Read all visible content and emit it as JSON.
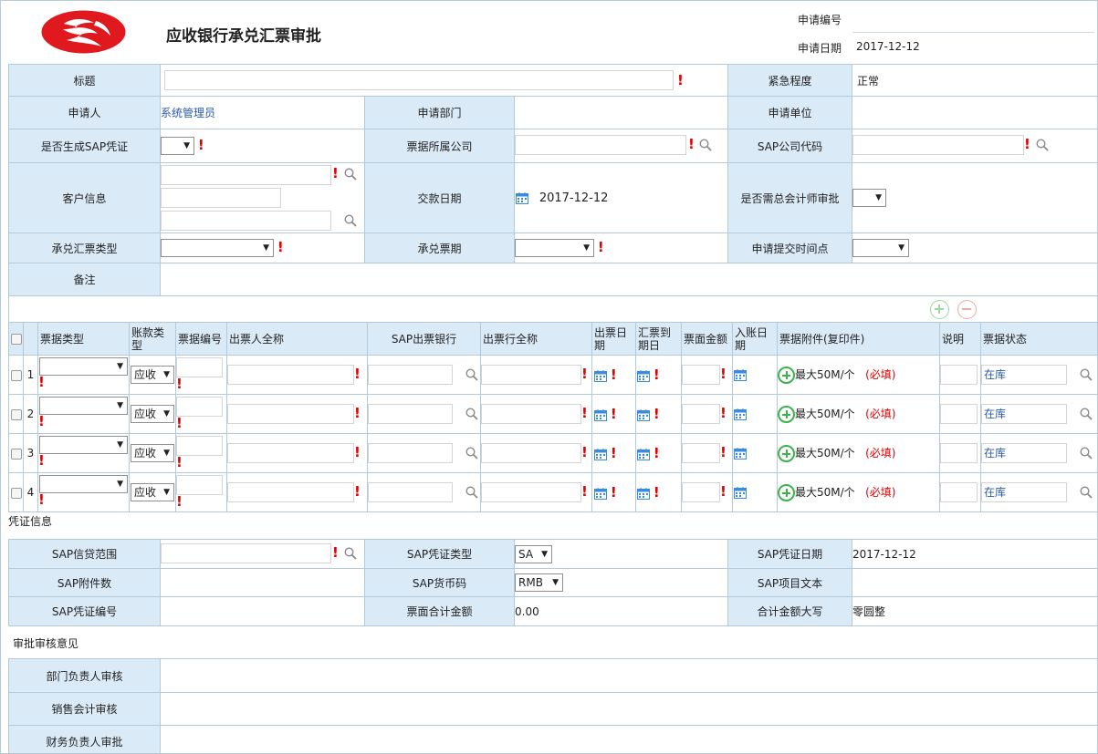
{
  "header": {
    "title": "应收银行承兑汇票审批",
    "apply_no_label": "申请编号",
    "apply_no": "",
    "apply_date_label": "申请日期",
    "apply_date": "2017-12-12",
    "brand_color": "#e0191e"
  },
  "form": {
    "title_label": "标题",
    "title_value": "",
    "urgency_label": "紧急程度",
    "urgency_value": "正常",
    "applicant_label": "申请人",
    "applicant_value": "系统管理员",
    "dept_label": "申请部门",
    "dept_value": "",
    "unit_label": "申请单位",
    "unit_value": "",
    "gen_sap_label": "是否生成SAP凭证",
    "gen_sap_value": "",
    "company_label": "票据所属公司",
    "company_value": "",
    "sap_code_label": "SAP公司代码",
    "sap_code_value": "",
    "customer_label": "客户信息",
    "pay_date_label": "交款日期",
    "pay_date_value": "2017-12-12",
    "chief_label": "是否需总会计师审批",
    "chief_value": "",
    "bill_type_label": "承兑汇票类型",
    "bill_type_value": "",
    "term_label": "承兑票期",
    "term_value": "",
    "submit_time_label": "申请提交时间点",
    "submit_time_value": "",
    "remark_label": "备注",
    "remark_value": ""
  },
  "grid": {
    "headers": [
      "票据类型",
      "账款类型",
      "票据编号",
      "出票人全称",
      "SAP出票银行",
      "出票行全称",
      "出票日期",
      "汇票到期日",
      "票面金额",
      "入账日期",
      "票据附件(复印件)",
      "说明",
      "票据状态"
    ],
    "rows": [
      {
        "no": "1",
        "account_type": "应收",
        "attach_hint": "最大50M/个",
        "attach_req": "(必填)",
        "status": "在库"
      },
      {
        "no": "2",
        "account_type": "应收",
        "attach_hint": "最大50M/个",
        "attach_req": "(必填)",
        "status": "在库"
      },
      {
        "no": "3",
        "account_type": "应收",
        "attach_hint": "最大50M/个",
        "attach_req": "(必填)",
        "status": "在库"
      },
      {
        "no": "4",
        "account_type": "应收",
        "attach_hint": "最大50M/个",
        "attach_req": "(必填)",
        "status": "在库"
      }
    ]
  },
  "voucher": {
    "section_label": "凭证信息",
    "credit_label": "SAP信贷范围",
    "credit_value": "",
    "vtype_label": "SAP凭证类型",
    "vtype_value": "SA",
    "vdate_label": "SAP凭证日期",
    "vdate_value": "2017-12-12",
    "attach_count_label": "SAP附件数",
    "attach_count_value": "",
    "currency_label": "SAP货币码",
    "currency_value": "RMB",
    "item_text_label": "SAP项目文本",
    "item_text_value": "",
    "vno_label": "SAP凭证编号",
    "vno_value": "",
    "total_label": "票面合计金额",
    "total_value": "0.00",
    "total_upper_label": "合计金额大写",
    "total_upper_value": "零圆整"
  },
  "approval": {
    "section_label": "审批审核意见",
    "dept_head_label": "部门负责人审核",
    "sales_acct_label": "销售会计审核",
    "fin_head_label": "财务负责人审批"
  },
  "icons": {
    "required": "!"
  }
}
